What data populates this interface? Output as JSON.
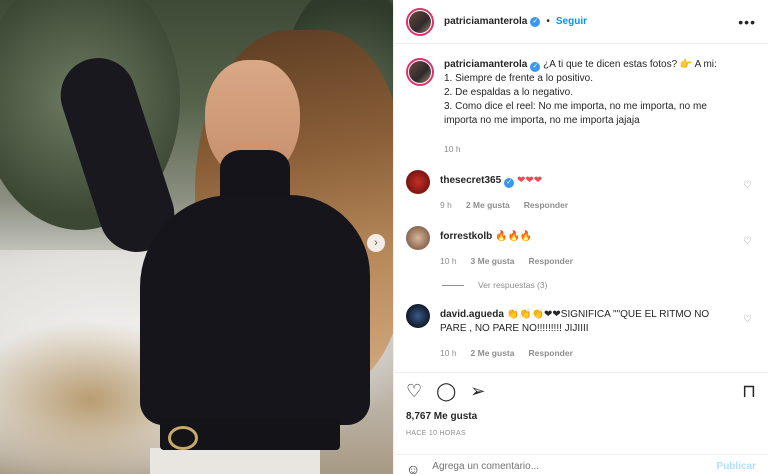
{
  "post": {
    "username": "patriciamanterola",
    "follow_label": "Seguir",
    "more_icon": "more-horizontal-icon",
    "next_icon": "chevron-right-icon"
  },
  "caption": {
    "username": "patriciamanterola",
    "line1": "¿A ti que te dicen estas fotos? 👉 A mi:",
    "line2": "1. Siempre de frente a lo positivo.",
    "line3": "2. De espaldas a lo negativo.",
    "line4": "3. Como dice el reel: No me importa, no me importa, no me importa no me importa, no me importa jajaja",
    "time": "10 h"
  },
  "comments": [
    {
      "username": "thesecret365",
      "verified": true,
      "text": "❤❤❤",
      "time": "9 h",
      "likes": "2 Me gusta",
      "reply": "Responder"
    },
    {
      "username": "forrestkolb",
      "verified": false,
      "text": "🔥🔥🔥",
      "time": "10 h",
      "likes": "3 Me gusta",
      "reply": "Responder",
      "view_replies": "Ver respuestas (3)"
    },
    {
      "username": "david.agueda",
      "verified": false,
      "text": "👏👏👏❤❤SIGNIFICA \"\"QUE EL RITMO NO PARE , NO PARE NO!!!!!!!!! JIJIIII",
      "time": "10 h",
      "likes": "2 Me gusta",
      "reply": "Responder"
    }
  ],
  "actions": {
    "likes": "8,767 Me gusta",
    "timestamp": "HACE 10 HORAS"
  },
  "compose": {
    "placeholder": "Agrega un comentario...",
    "publish_label": "Publicar"
  },
  "colors": {
    "link_blue": "#0095f6",
    "heart_red": "#ed4956",
    "muted": "#8e8e8e"
  }
}
